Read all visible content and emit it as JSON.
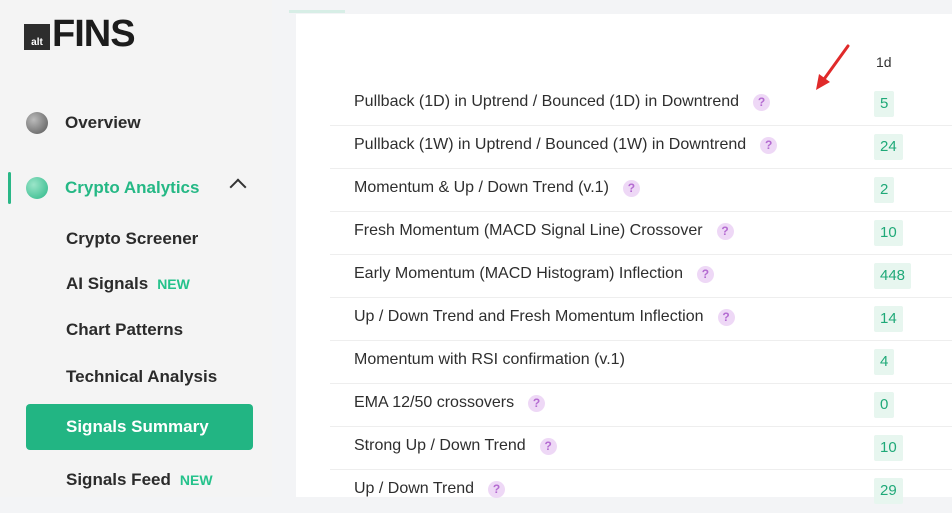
{
  "logo": {
    "box": "alt",
    "text": "FINS"
  },
  "sidebar": {
    "overview": "Overview",
    "crypto_analytics": "Crypto Analytics",
    "items": [
      {
        "label": "Crypto Screener",
        "badge": ""
      },
      {
        "label": "AI Signals",
        "badge": "NEW"
      },
      {
        "label": "Chart Patterns",
        "badge": ""
      },
      {
        "label": "Technical Analysis",
        "badge": ""
      },
      {
        "label": "Signals Summary",
        "badge": ""
      },
      {
        "label": "Signals Feed",
        "badge": "NEW"
      }
    ]
  },
  "table": {
    "column_header": "1d",
    "rows": [
      {
        "label": "Pullback (1D) in Uptrend / Bounced (1D) in Downtrend",
        "count": "5"
      },
      {
        "label": "Pullback (1W) in Uptrend / Bounced (1W) in Downtrend",
        "count": "24"
      },
      {
        "label": "Momentum & Up / Down Trend (v.1)",
        "count": "2"
      },
      {
        "label": "Fresh Momentum (MACD Signal Line) Crossover",
        "count": "10"
      },
      {
        "label": "Early Momentum (MACD Histogram) Inflection",
        "count": "448"
      },
      {
        "label": "Up / Down Trend and Fresh Momentum Inflection",
        "count": "14"
      },
      {
        "label": "Momentum with RSI confirmation (v.1)",
        "count": "4"
      },
      {
        "label": "EMA 12/50 crossovers",
        "count": "0"
      },
      {
        "label": "Strong Up / Down Trend",
        "count": "10"
      },
      {
        "label": "Up / Down Trend",
        "count": "29"
      }
    ],
    "help_glyph": "?"
  },
  "colors": {
    "accent": "#22b583",
    "help": "#b46bd1",
    "arrow": "#e02a2a"
  }
}
